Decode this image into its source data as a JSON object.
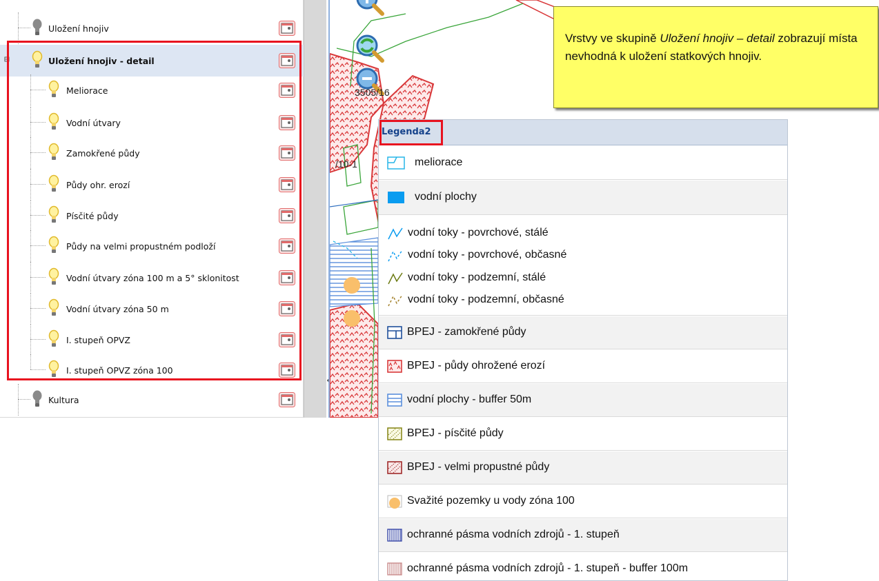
{
  "tree": {
    "items": [
      {
        "label": "Uložení hnojiv",
        "bulb": "off"
      },
      {
        "label": "Uložení hnojiv - detail",
        "bulb": "on",
        "selected": true,
        "expanded": true
      },
      {
        "label": "Meliorace",
        "bulb": "on"
      },
      {
        "label": "Vodní útvary",
        "bulb": "on"
      },
      {
        "label": "Zamokřené půdy",
        "bulb": "on"
      },
      {
        "label": "Půdy ohr. erozí",
        "bulb": "on"
      },
      {
        "label": "Písčité půdy",
        "bulb": "on"
      },
      {
        "label": "Půdy na velmi propustném podloží",
        "bulb": "on"
      },
      {
        "label": "Vodní útvary zóna 100 m a 5° sklonitost",
        "bulb": "on"
      },
      {
        "label": "Vodní útvary zóna 50 m",
        "bulb": "on"
      },
      {
        "label": "I. stupeň OPVZ",
        "bulb": "on"
      },
      {
        "label": "I. stupeň OPVZ zóna 100",
        "bulb": "on"
      },
      {
        "label": "Kultura",
        "bulb": "off"
      }
    ],
    "collapse_symbol": "⊟",
    "icons": {
      "bulb_on": "lightbulb-on-icon",
      "bulb_off": "lightbulb-off-icon",
      "legend": "legend-icon"
    }
  },
  "map": {
    "parcel_label_1": "3505/16",
    "parcel_label_2": "/10-1",
    "tools": [
      "zoom-in-icon",
      "zoom-extent-icon",
      "zoom-out-icon"
    ]
  },
  "callout": {
    "text_before": "Vrstvy ve skupině ",
    "text_em": "Uložení hnojiv – detail",
    "text_after": " zobrazují místa nevhodná k uložení statkových hnojiv."
  },
  "legend": {
    "title": "Legenda2",
    "items": [
      {
        "label": "meliorace",
        "symbol": "meliorace"
      },
      {
        "label": "vodní plochy",
        "symbol": "water-area"
      },
      {
        "label": "vodní toky - povrchové, stálé",
        "symbol": "stream-surface-permanent"
      },
      {
        "label": "vodní toky - povrchové, občasné",
        "symbol": "stream-surface-intermittent"
      },
      {
        "label": "vodní toky - podzemní, stálé",
        "symbol": "stream-underground-permanent"
      },
      {
        "label": "vodní toky - podzemní, občasné",
        "symbol": "stream-underground-intermittent"
      },
      {
        "label": "BPEJ - zamokřené půdy",
        "symbol": "wetlands"
      },
      {
        "label": "BPEJ - půdy ohrožené erozí",
        "symbol": "erosion"
      },
      {
        "label": "vodní plochy - buffer 50m",
        "symbol": "water-buffer"
      },
      {
        "label": "BPEJ - písčité půdy",
        "symbol": "sandy"
      },
      {
        "label": "BPEJ - velmi propustné půdy",
        "symbol": "permeable"
      },
      {
        "label": "Svažité pozemky u vody zóna 100",
        "symbol": "slope"
      },
      {
        "label": "ochranné pásma vodních zdrojů - 1. stupeň",
        "symbol": "protection-zone"
      },
      {
        "label": "ochranné pásma vodních zdrojů - 1. stupeň - buffer 100m",
        "symbol": "protection-zone-buffer"
      }
    ]
  },
  "colors": {
    "highlight_frame": "#e8121f",
    "callout_bg": "#ffff66",
    "legend_header_bg": "#d6dfec",
    "legend_title": "#15428b",
    "erosion_red": "#d9383a",
    "water_blue": "#0a9cf0",
    "stream_green": "#3aa53a"
  }
}
